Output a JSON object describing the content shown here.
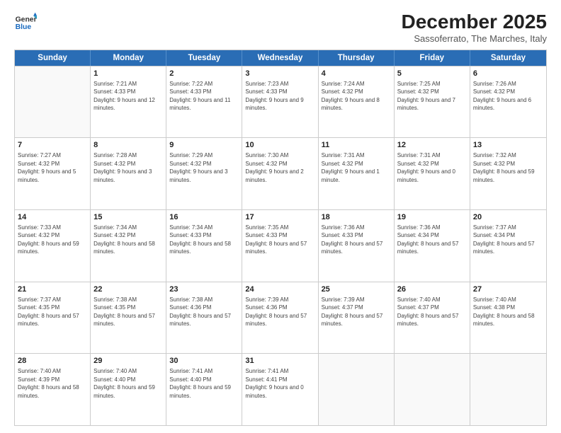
{
  "logo": {
    "line1": "General",
    "line2": "Blue"
  },
  "title": "December 2025",
  "subtitle": "Sassoferrato, The Marches, Italy",
  "header": {
    "days": [
      "Sunday",
      "Monday",
      "Tuesday",
      "Wednesday",
      "Thursday",
      "Friday",
      "Saturday"
    ]
  },
  "rows": [
    [
      {
        "day": "",
        "sunrise": "",
        "sunset": "",
        "daylight": ""
      },
      {
        "day": "1",
        "sunrise": "Sunrise: 7:21 AM",
        "sunset": "Sunset: 4:33 PM",
        "daylight": "Daylight: 9 hours and 12 minutes."
      },
      {
        "day": "2",
        "sunrise": "Sunrise: 7:22 AM",
        "sunset": "Sunset: 4:33 PM",
        "daylight": "Daylight: 9 hours and 11 minutes."
      },
      {
        "day": "3",
        "sunrise": "Sunrise: 7:23 AM",
        "sunset": "Sunset: 4:33 PM",
        "daylight": "Daylight: 9 hours and 9 minutes."
      },
      {
        "day": "4",
        "sunrise": "Sunrise: 7:24 AM",
        "sunset": "Sunset: 4:32 PM",
        "daylight": "Daylight: 9 hours and 8 minutes."
      },
      {
        "day": "5",
        "sunrise": "Sunrise: 7:25 AM",
        "sunset": "Sunset: 4:32 PM",
        "daylight": "Daylight: 9 hours and 7 minutes."
      },
      {
        "day": "6",
        "sunrise": "Sunrise: 7:26 AM",
        "sunset": "Sunset: 4:32 PM",
        "daylight": "Daylight: 9 hours and 6 minutes."
      }
    ],
    [
      {
        "day": "7",
        "sunrise": "Sunrise: 7:27 AM",
        "sunset": "Sunset: 4:32 PM",
        "daylight": "Daylight: 9 hours and 5 minutes."
      },
      {
        "day": "8",
        "sunrise": "Sunrise: 7:28 AM",
        "sunset": "Sunset: 4:32 PM",
        "daylight": "Daylight: 9 hours and 3 minutes."
      },
      {
        "day": "9",
        "sunrise": "Sunrise: 7:29 AM",
        "sunset": "Sunset: 4:32 PM",
        "daylight": "Daylight: 9 hours and 3 minutes."
      },
      {
        "day": "10",
        "sunrise": "Sunrise: 7:30 AM",
        "sunset": "Sunset: 4:32 PM",
        "daylight": "Daylight: 9 hours and 2 minutes."
      },
      {
        "day": "11",
        "sunrise": "Sunrise: 7:31 AM",
        "sunset": "Sunset: 4:32 PM",
        "daylight": "Daylight: 9 hours and 1 minute."
      },
      {
        "day": "12",
        "sunrise": "Sunrise: 7:31 AM",
        "sunset": "Sunset: 4:32 PM",
        "daylight": "Daylight: 9 hours and 0 minutes."
      },
      {
        "day": "13",
        "sunrise": "Sunrise: 7:32 AM",
        "sunset": "Sunset: 4:32 PM",
        "daylight": "Daylight: 8 hours and 59 minutes."
      }
    ],
    [
      {
        "day": "14",
        "sunrise": "Sunrise: 7:33 AM",
        "sunset": "Sunset: 4:32 PM",
        "daylight": "Daylight: 8 hours and 59 minutes."
      },
      {
        "day": "15",
        "sunrise": "Sunrise: 7:34 AM",
        "sunset": "Sunset: 4:32 PM",
        "daylight": "Daylight: 8 hours and 58 minutes."
      },
      {
        "day": "16",
        "sunrise": "Sunrise: 7:34 AM",
        "sunset": "Sunset: 4:33 PM",
        "daylight": "Daylight: 8 hours and 58 minutes."
      },
      {
        "day": "17",
        "sunrise": "Sunrise: 7:35 AM",
        "sunset": "Sunset: 4:33 PM",
        "daylight": "Daylight: 8 hours and 57 minutes."
      },
      {
        "day": "18",
        "sunrise": "Sunrise: 7:36 AM",
        "sunset": "Sunset: 4:33 PM",
        "daylight": "Daylight: 8 hours and 57 minutes."
      },
      {
        "day": "19",
        "sunrise": "Sunrise: 7:36 AM",
        "sunset": "Sunset: 4:34 PM",
        "daylight": "Daylight: 8 hours and 57 minutes."
      },
      {
        "day": "20",
        "sunrise": "Sunrise: 7:37 AM",
        "sunset": "Sunset: 4:34 PM",
        "daylight": "Daylight: 8 hours and 57 minutes."
      }
    ],
    [
      {
        "day": "21",
        "sunrise": "Sunrise: 7:37 AM",
        "sunset": "Sunset: 4:35 PM",
        "daylight": "Daylight: 8 hours and 57 minutes."
      },
      {
        "day": "22",
        "sunrise": "Sunrise: 7:38 AM",
        "sunset": "Sunset: 4:35 PM",
        "daylight": "Daylight: 8 hours and 57 minutes."
      },
      {
        "day": "23",
        "sunrise": "Sunrise: 7:38 AM",
        "sunset": "Sunset: 4:36 PM",
        "daylight": "Daylight: 8 hours and 57 minutes."
      },
      {
        "day": "24",
        "sunrise": "Sunrise: 7:39 AM",
        "sunset": "Sunset: 4:36 PM",
        "daylight": "Daylight: 8 hours and 57 minutes."
      },
      {
        "day": "25",
        "sunrise": "Sunrise: 7:39 AM",
        "sunset": "Sunset: 4:37 PM",
        "daylight": "Daylight: 8 hours and 57 minutes."
      },
      {
        "day": "26",
        "sunrise": "Sunrise: 7:40 AM",
        "sunset": "Sunset: 4:37 PM",
        "daylight": "Daylight: 8 hours and 57 minutes."
      },
      {
        "day": "27",
        "sunrise": "Sunrise: 7:40 AM",
        "sunset": "Sunset: 4:38 PM",
        "daylight": "Daylight: 8 hours and 58 minutes."
      }
    ],
    [
      {
        "day": "28",
        "sunrise": "Sunrise: 7:40 AM",
        "sunset": "Sunset: 4:39 PM",
        "daylight": "Daylight: 8 hours and 58 minutes."
      },
      {
        "day": "29",
        "sunrise": "Sunrise: 7:40 AM",
        "sunset": "Sunset: 4:40 PM",
        "daylight": "Daylight: 8 hours and 59 minutes."
      },
      {
        "day": "30",
        "sunrise": "Sunrise: 7:41 AM",
        "sunset": "Sunset: 4:40 PM",
        "daylight": "Daylight: 8 hours and 59 minutes."
      },
      {
        "day": "31",
        "sunrise": "Sunrise: 7:41 AM",
        "sunset": "Sunset: 4:41 PM",
        "daylight": "Daylight: 9 hours and 0 minutes."
      },
      {
        "day": "",
        "sunrise": "",
        "sunset": "",
        "daylight": ""
      },
      {
        "day": "",
        "sunrise": "",
        "sunset": "",
        "daylight": ""
      },
      {
        "day": "",
        "sunrise": "",
        "sunset": "",
        "daylight": ""
      }
    ]
  ]
}
